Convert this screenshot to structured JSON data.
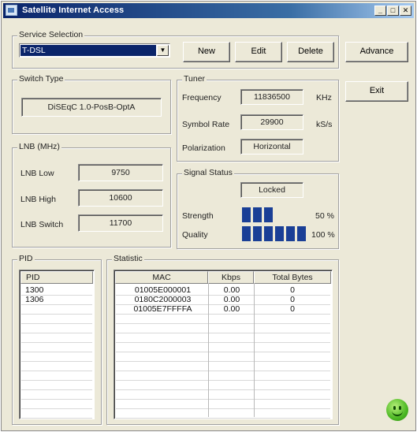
{
  "window": {
    "title": "Satellite Internet Access",
    "controls": {
      "minimize": "_",
      "maximize": "□",
      "close": "✕"
    }
  },
  "service_selection": {
    "label": "Service Selection",
    "selected": "T-DSL",
    "buttons": {
      "new": "New",
      "edit": "Edit",
      "delete": "Delete"
    }
  },
  "side_buttons": {
    "advance": "Advance",
    "exit": "Exit"
  },
  "switch_type": {
    "label": "Switch Type",
    "value": "DiSEqC 1.0-PosB-OptA"
  },
  "tuner": {
    "label": "Tuner",
    "frequency": {
      "label": "Frequency",
      "value": "11836500",
      "unit": "KHz"
    },
    "symbol_rate": {
      "label": "Symbol Rate",
      "value": "29900",
      "unit": "kS/s"
    },
    "polarization": {
      "label": "Polarization",
      "value": "Horizontal"
    }
  },
  "lnb": {
    "label": "LNB (MHz)",
    "low": {
      "label": "LNB Low",
      "value": "9750"
    },
    "high": {
      "label": "LNB High",
      "value": "10600"
    },
    "switch": {
      "label": "LNB Switch",
      "value": "11700"
    }
  },
  "signal_status": {
    "label": "Signal Status",
    "lock": "Locked",
    "strength": {
      "label": "Strength",
      "text": "50 %",
      "level_percent": 50
    },
    "quality": {
      "label": "Quality",
      "text": "100 %",
      "level_percent": 100
    }
  },
  "pid": {
    "label": "PID",
    "column": "PID",
    "rows": [
      "1300",
      "1306"
    ]
  },
  "statistic": {
    "label": "Statistic",
    "columns": [
      "MAC",
      "Kbps",
      "Total Bytes"
    ],
    "rows": [
      [
        "01005E000001",
        "0.00",
        "0"
      ],
      [
        "0180C2000003",
        "0.00",
        "0"
      ],
      [
        "01005E7FFFFA",
        "0.00",
        "0"
      ]
    ]
  },
  "status_icon": "green-smiley-icon",
  "colors": {
    "titlebar": "#0a246a",
    "selection": "#0a246a",
    "meter": "#1a3f96",
    "status_ok": "#4cb824"
  }
}
